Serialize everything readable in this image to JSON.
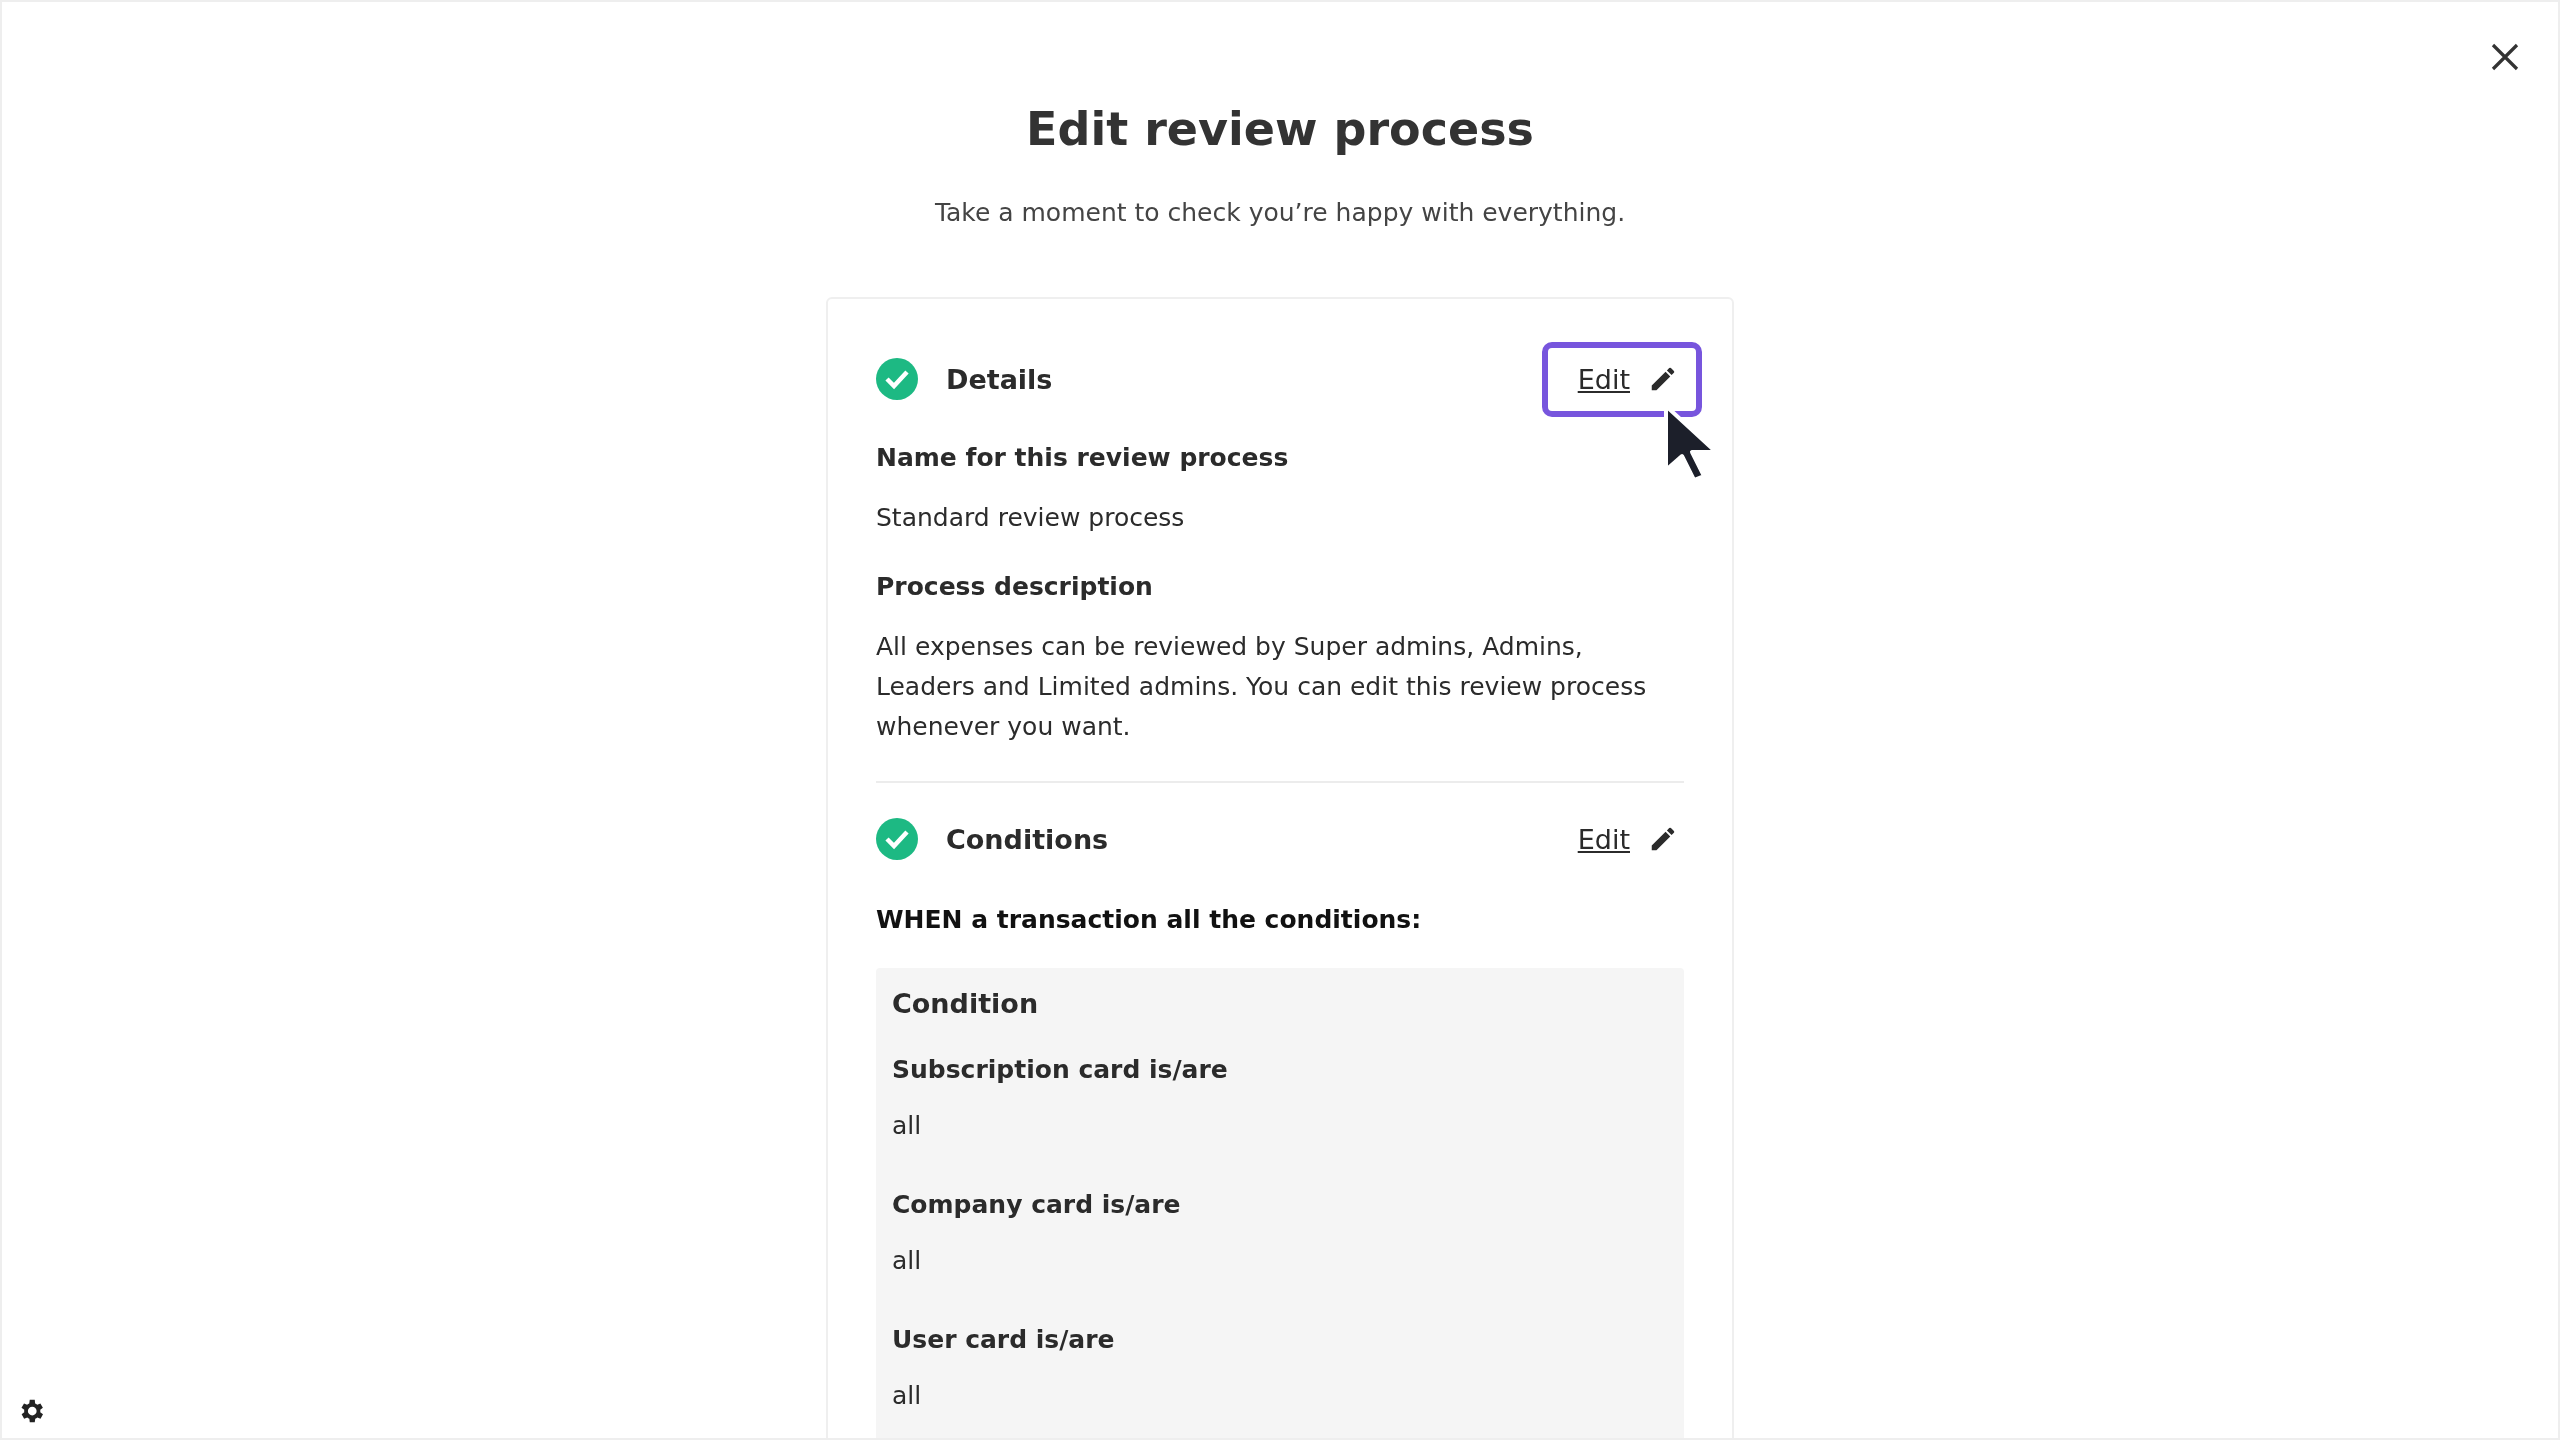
{
  "title": "Edit review process",
  "subtitle": "Take a moment to check you’re happy with everything.",
  "sections": [
    {
      "title": "Details",
      "complete": true,
      "edit": {
        "label": "Edit",
        "focused": true
      },
      "kind": "fields",
      "fields": [
        {
          "label": "Name for this review process",
          "value": "Standard review process"
        },
        {
          "label": "Process description",
          "value": "All expenses can be reviewed by Super admins, Admins, Leaders and Limited admins. You can edit this review process whenever you want."
        }
      ]
    },
    {
      "title": "Conditions",
      "complete": true,
      "edit": {
        "label": "Edit",
        "focused": false
      },
      "kind": "conditions",
      "intro": "WHEN a transaction all the conditions:",
      "panel_title": "Condition",
      "conditions": [
        {
          "label": "Subscription card is/are",
          "value": "all"
        },
        {
          "label": "Company card is/are",
          "value": "all"
        },
        {
          "label": "User card is/are",
          "value": "all"
        }
      ]
    }
  ]
}
